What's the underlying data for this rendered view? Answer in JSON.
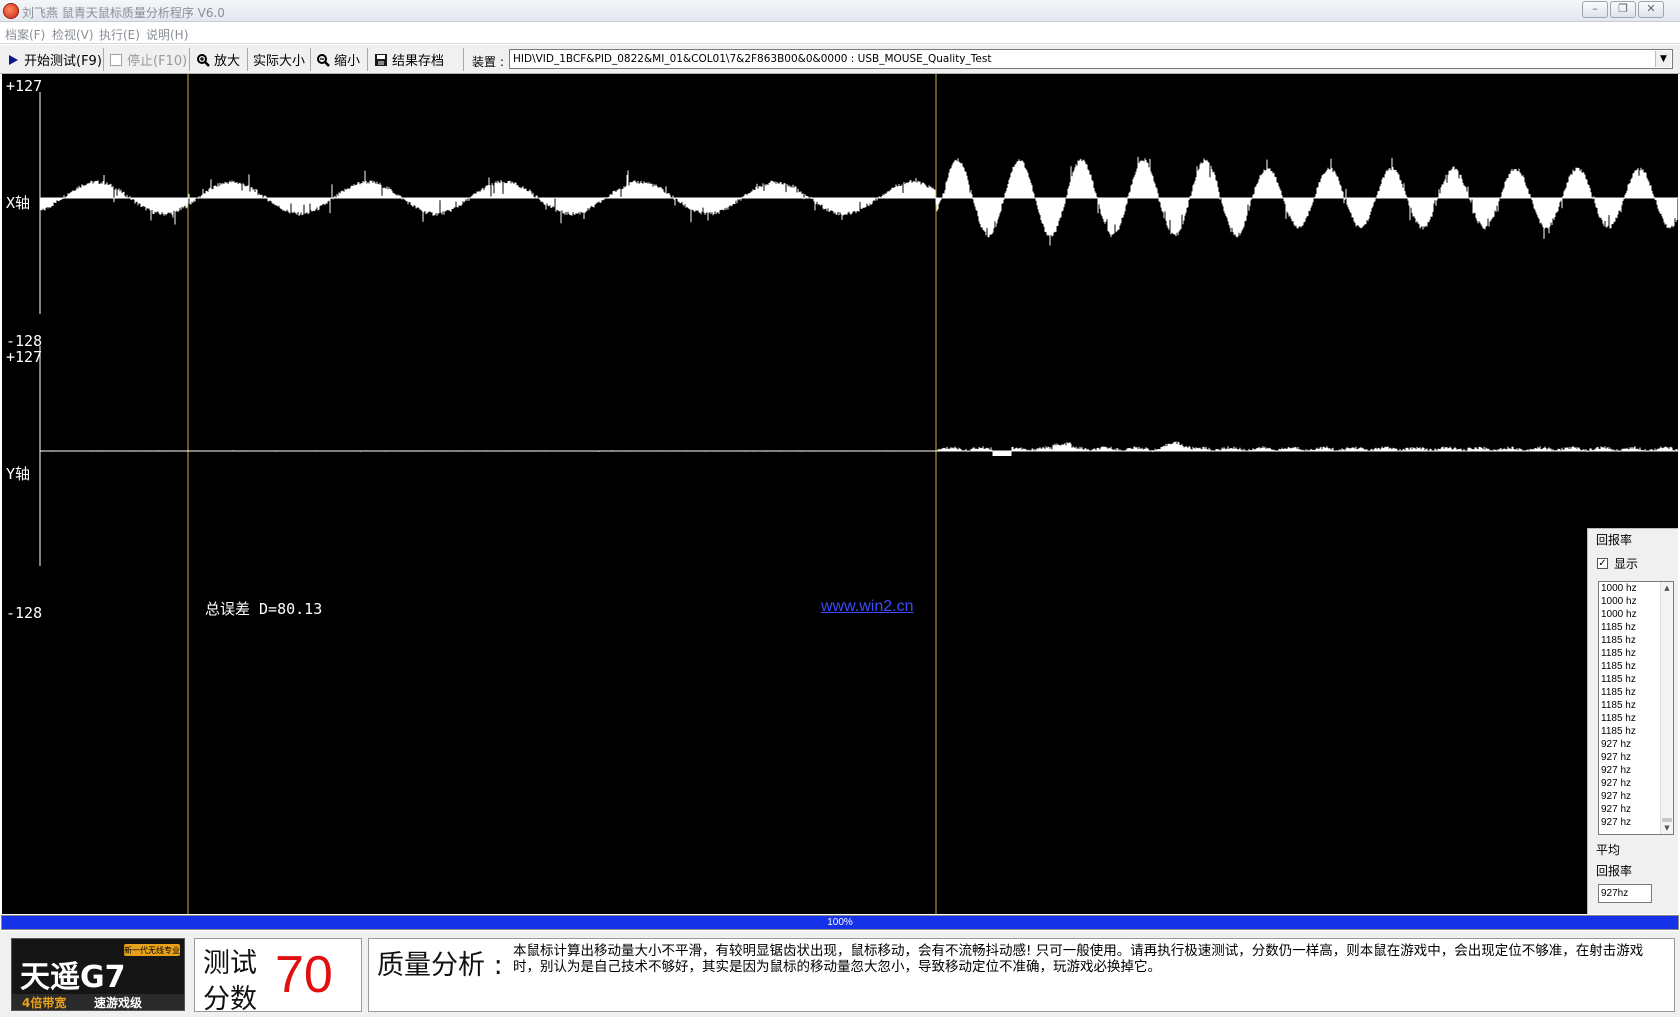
{
  "window": {
    "title": "刘飞燕 鼠青天鼠标质量分析程序 V6.0",
    "controls": {
      "minimize": "–",
      "maximize": "❐",
      "close": "✕"
    }
  },
  "menu": [
    "档案(F)",
    "检视(V)",
    "执行(E)",
    "说明(H)"
  ],
  "toolbar": {
    "start": "开始测试(F9)",
    "stop": "停止(F10)",
    "zoom_in": "放大",
    "actual_size": "实际大小",
    "zoom_out": "缩小",
    "save": "结果存档",
    "device_label": "装置 :",
    "device_value": "HID\\VID_1BCF&PID_0822&MI_01&COL01\\7&2F863B00&0&0000  :  USB_MOUSE_Quality_Test"
  },
  "graph": {
    "x_axis": {
      "label": "X轴",
      "max": "+127",
      "min": "-128"
    },
    "y_axis": {
      "label": "Y轴",
      "max": "+127",
      "min": "-128"
    },
    "error_label": "总误差 D=80.13",
    "link": "www.win2.cn",
    "colors": {
      "background": "#000000",
      "signal": "#ffffff",
      "marker": "#c8b43a"
    }
  },
  "chart_data": {
    "type": "area",
    "series": [
      {
        "name": "X轴",
        "pattern": "sine oscillation, low amplitude then higher amplitude after second marker"
      },
      {
        "name": "Y轴",
        "pattern": "near zero, small bumps after second marker"
      }
    ],
    "ylim": [
      -128,
      127
    ]
  },
  "report_rate": {
    "group_title": "回报率",
    "show_label": "显示",
    "show_checked": true,
    "items": [
      "1000 hz",
      "1000 hz",
      "1000 hz",
      "1185 hz",
      "1185 hz",
      "1185 hz",
      "1185 hz",
      "1185 hz",
      "1185 hz",
      "1185 hz",
      "1185 hz",
      "1185 hz",
      "927 hz",
      "927 hz",
      "927 hz",
      "927 hz",
      "927 hz",
      "927 hz",
      "927 hz"
    ],
    "avg_label_1": "平均",
    "avg_label_2": "回报率",
    "avg_value": "927hz"
  },
  "progress": {
    "value": 1.0,
    "text": "100%"
  },
  "score": {
    "label_1": "测试",
    "label_2": "分数",
    "value": "70"
  },
  "analysis": {
    "title": "质量分析 :",
    "text": "本鼠标计算出移动量大小不平滑，有较明显锯齿状出现，鼠标移动，会有不流畅抖动感! 只可一般使用。请再执行极速测试，分数仍一样高，则本鼠在游戏中，会出现定位不够准，在射击游戏时，别认为是自己技术不够好，其实是因为鼠标的移动量忽大忽小，导致移动定位不准确，玩游戏必换掉它。"
  },
  "logo": {
    "brand": "天遥G7",
    "tag": "新一代无线专业",
    "slogan": "4倍带宽 速游戏级"
  }
}
